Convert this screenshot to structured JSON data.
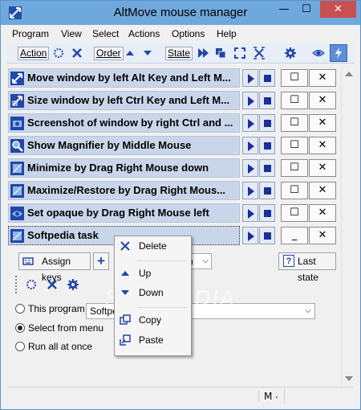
{
  "window": {
    "title": "AltMove mouse manager",
    "min_glyph": "—",
    "max_glyph": "☐",
    "close_glyph": "✕"
  },
  "menu": [
    "Program",
    "View",
    "Select",
    "Actions",
    "Options",
    "Help"
  ],
  "toolbar": {
    "action_label": "Action",
    "order_label": "Order",
    "state_label": "State"
  },
  "tasks": [
    {
      "label": "Move window by left Alt Key and Left M...",
      "icon": "move-icon"
    },
    {
      "label": "Size window by left Ctrl Key and Left M...",
      "icon": "resize-icon"
    },
    {
      "label": "Screenshot of window by right Ctrl and ...",
      "icon": "camera-icon"
    },
    {
      "label": "Show Magnifier by Middle Mouse",
      "icon": "magnifier-icon"
    },
    {
      "label": "Minimize by Drag Right Mouse down",
      "icon": "window-icon"
    },
    {
      "label": "Maximize/Restore by Drag Right Mous...",
      "icon": "window-icon"
    },
    {
      "label": "Set opaque by Drag Right Mouse left",
      "icon": "eye-icon"
    },
    {
      "label": "Softpedia task",
      "icon": "window-icon"
    }
  ],
  "row_buttons": {
    "restore_glyph": "☐",
    "close_glyph": "✕",
    "minimize_glyph": "_"
  },
  "panel": {
    "assign_keys_label": "Assign keys",
    "add_glyph": "+",
    "hidden_combo_text": "n",
    "last_state_label": "Last state",
    "radio_this_program": "This program",
    "radio_select_menu": "Select from menu",
    "radio_run_all": "Run all at once",
    "program_combo_value": "Softpe"
  },
  "context_menu": [
    {
      "label": "Delete",
      "icon": "delete-icon"
    },
    {
      "label": "Up",
      "icon": "up-arrow-icon"
    },
    {
      "label": "Down",
      "icon": "down-arrow-icon"
    },
    {
      "label": "Copy",
      "icon": "copy-icon"
    },
    {
      "label": "Paste",
      "icon": "paste-icon"
    }
  ],
  "statusbar": {
    "mode": "M",
    "extra": "."
  },
  "watermark": "SOFTPEDIA"
}
